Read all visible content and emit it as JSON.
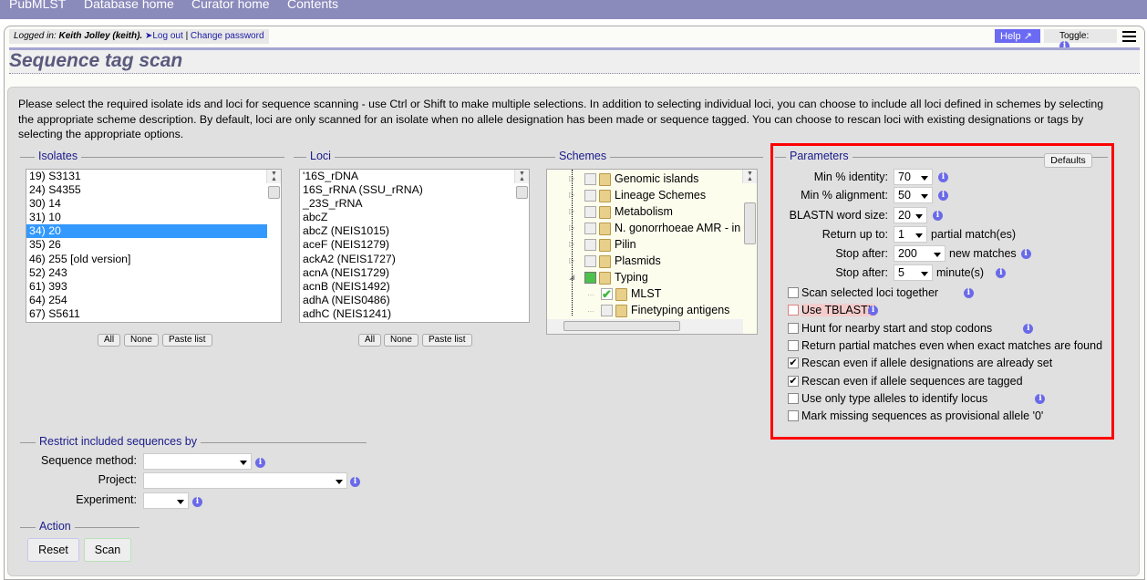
{
  "nav": {
    "items": [
      "PubMLST",
      "Database home",
      "Curator home",
      "Contents"
    ],
    "color": "#8a8abb"
  },
  "login": {
    "prefix": "Logged in:",
    "user": "Keith Jolley (keith).",
    "logout": "Log out",
    "sep": "|",
    "change_password": "Change password"
  },
  "header": {
    "help": "Help",
    "toggle": "Toggle:",
    "title": "Sequence tag scan"
  },
  "intro": "Please select the required isolate ids and loci for sequence scanning - use Ctrl or Shift to make multiple selections. In addition to selecting individual loci, you can choose to include all loci defined in schemes by selecting the appropriate scheme description. By default, loci are only scanned for an isolate when no allele designation has been made or sequence tagged. You can choose to rescan loci with existing designations or tags by selecting the appropriate options.",
  "isolates": {
    "legend": "Isolates",
    "items": [
      "19) S3131",
      "24) S4355",
      "30) 14",
      "31) 10",
      "34) 20",
      "35) 26",
      "46) 255 [old version]",
      "52) 243",
      "61) 393",
      "64) 254",
      "67) S5611"
    ],
    "selected": "34) 20",
    "buttons": [
      "All",
      "None",
      "Paste list"
    ]
  },
  "loci": {
    "legend": "Loci",
    "items": [
      "'16S_rDNA",
      "16S_rRNA (SSU_rRNA)",
      "_23S_rRNA",
      "abcZ",
      "abcZ (NEIS1015)",
      "aceF (NEIS1279)",
      "ackA2 (NEIS1727)",
      "acnA (NEIS1729)",
      "acnB (NEIS1492)",
      "adhA (NEIS0486)",
      "adhC (NEIS1241)"
    ],
    "buttons": [
      "All",
      "None",
      "Paste list"
    ]
  },
  "schemes": {
    "legend": "Schemes",
    "items": [
      {
        "label": "Genomic islands",
        "checked": false,
        "level": 0
      },
      {
        "label": "Lineage Schemes",
        "checked": false,
        "level": 0
      },
      {
        "label": "Metabolism",
        "checked": false,
        "level": 0
      },
      {
        "label": "N. gonorrhoeae AMR - in d",
        "checked": false,
        "level": 0
      },
      {
        "label": "Pilin",
        "checked": false,
        "level": 0
      },
      {
        "label": "Plasmids",
        "checked": false,
        "level": 0
      },
      {
        "label": "Typing",
        "checked": "partial",
        "level": 0
      },
      {
        "label": "MLST",
        "checked": true,
        "level": 1
      },
      {
        "label": "Finetyping antigens",
        "checked": false,
        "level": 1
      }
    ]
  },
  "parameters": {
    "legend": "Parameters",
    "defaults": "Defaults",
    "min_identity": {
      "label": "Min % identity:",
      "value": "70"
    },
    "min_alignment": {
      "label": "Min % alignment:",
      "value": "50"
    },
    "word_size": {
      "label": "BLASTN word size:",
      "value": "20"
    },
    "return_up_to": {
      "label": "Return up to:",
      "value": "1",
      "suffix": "partial match(es)"
    },
    "stop_matches": {
      "label": "Stop after:",
      "value": "200",
      "suffix": "new matches"
    },
    "stop_minutes": {
      "label": "Stop after:",
      "value": "5",
      "suffix": "minute(s)"
    },
    "options": [
      {
        "label": "Scan selected loci together",
        "checked": false,
        "info": true
      },
      {
        "label": "Use TBLASTX",
        "checked": false,
        "info": true
      },
      {
        "label": "Hunt for nearby start and stop codons",
        "checked": false,
        "info": true
      },
      {
        "label": "Return partial matches even when exact matches are found",
        "checked": false,
        "info": false
      },
      {
        "label": "Rescan even if allele designations are already set",
        "checked": true,
        "info": false
      },
      {
        "label": "Rescan even if allele sequences are tagged",
        "checked": true,
        "info": false
      },
      {
        "label": "Use only type alleles to identify locus",
        "checked": false,
        "info": true
      },
      {
        "label": "Mark missing sequences as provisional allele '0'",
        "checked": false,
        "info": false
      }
    ]
  },
  "restrict": {
    "legend": "Restrict included sequences by",
    "sequence_method": {
      "label": "Sequence method:",
      "value": ""
    },
    "project": {
      "label": "Project:",
      "value": ""
    },
    "experiment": {
      "label": "Experiment:",
      "value": ""
    }
  },
  "action": {
    "legend": "Action",
    "reset": "Reset",
    "scan": "Scan"
  },
  "highlight_color": "#ff0000"
}
